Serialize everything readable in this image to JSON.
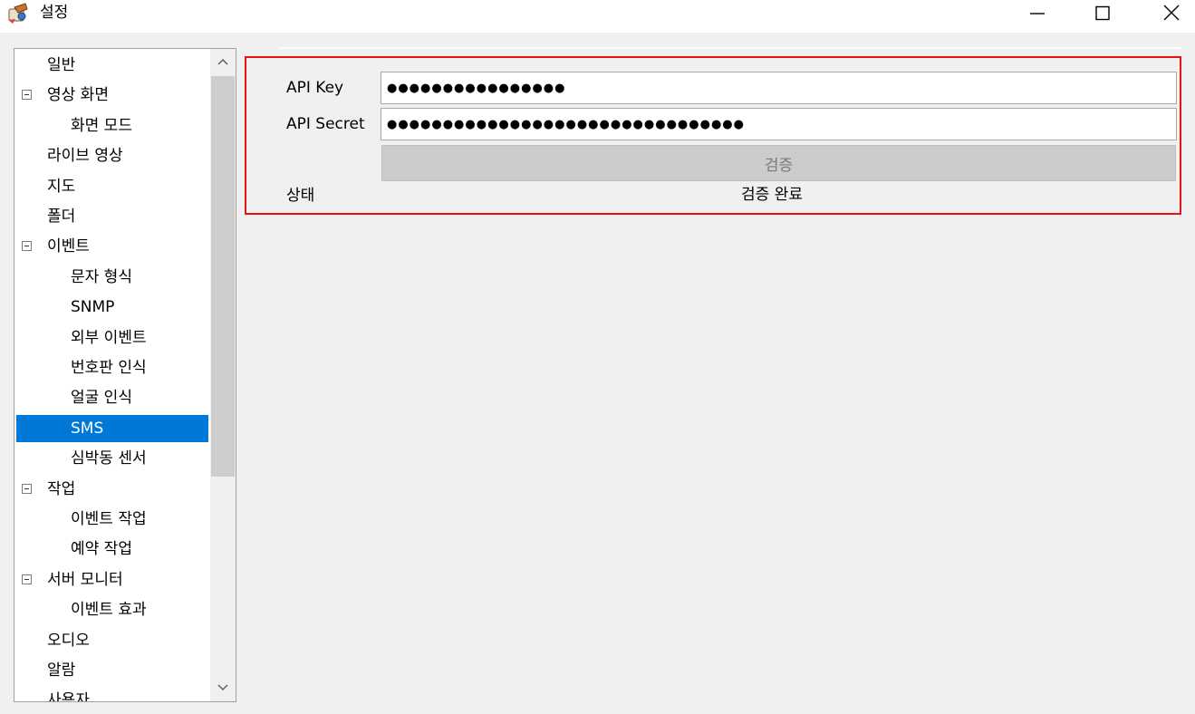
{
  "window": {
    "title": "설정",
    "app_icon": "settings-app-icon",
    "controls": [
      "minimize-icon",
      "maximize-icon",
      "close-icon"
    ]
  },
  "tree": {
    "items": [
      {
        "label": "일반",
        "level": 0,
        "expander": false,
        "selected": false
      },
      {
        "label": "영상 화면",
        "level": 0,
        "expander": true,
        "selected": false
      },
      {
        "label": "화면 모드",
        "level": 1,
        "expander": false,
        "selected": false
      },
      {
        "label": "라이브 영상",
        "level": 0,
        "expander": false,
        "selected": false
      },
      {
        "label": "지도",
        "level": 0,
        "expander": false,
        "selected": false
      },
      {
        "label": "폴더",
        "level": 0,
        "expander": false,
        "selected": false
      },
      {
        "label": "이벤트",
        "level": 0,
        "expander": true,
        "selected": false
      },
      {
        "label": "문자 형식",
        "level": 1,
        "expander": false,
        "selected": false
      },
      {
        "label": "SNMP",
        "level": 1,
        "expander": false,
        "selected": false
      },
      {
        "label": "외부 이벤트",
        "level": 1,
        "expander": false,
        "selected": false
      },
      {
        "label": "번호판 인식",
        "level": 1,
        "expander": false,
        "selected": false
      },
      {
        "label": "얼굴 인식",
        "level": 1,
        "expander": false,
        "selected": false
      },
      {
        "label": "SMS",
        "level": 1,
        "expander": false,
        "selected": true
      },
      {
        "label": "심박동 센서",
        "level": 1,
        "expander": false,
        "selected": false
      },
      {
        "label": "작업",
        "level": 0,
        "expander": true,
        "selected": false
      },
      {
        "label": "이벤트 작업",
        "level": 1,
        "expander": false,
        "selected": false
      },
      {
        "label": "예약 작업",
        "level": 1,
        "expander": false,
        "selected": false
      },
      {
        "label": "서버 모니터",
        "level": 0,
        "expander": true,
        "selected": false
      },
      {
        "label": "이벤트 효과",
        "level": 1,
        "expander": false,
        "selected": false
      },
      {
        "label": "오디오",
        "level": 0,
        "expander": false,
        "selected": false
      },
      {
        "label": "알람",
        "level": 0,
        "expander": false,
        "selected": false
      },
      {
        "label": "사용자",
        "level": 0,
        "expander": false,
        "selected": false
      }
    ]
  },
  "sms": {
    "api_key_label": "API Key",
    "api_key_value": "●●●●●●●●●●●●●●●●",
    "api_secret_label": "API Secret",
    "api_secret_value": "●●●●●●●●●●●●●●●●●●●●●●●●●●●●●●●●",
    "verify_button": "검증",
    "status_label": "상태",
    "status_value": "검증 완료"
  },
  "colors": {
    "selection": "#0078d7",
    "highlight_border": "#e01515",
    "disabled_button": "#cccccc"
  }
}
